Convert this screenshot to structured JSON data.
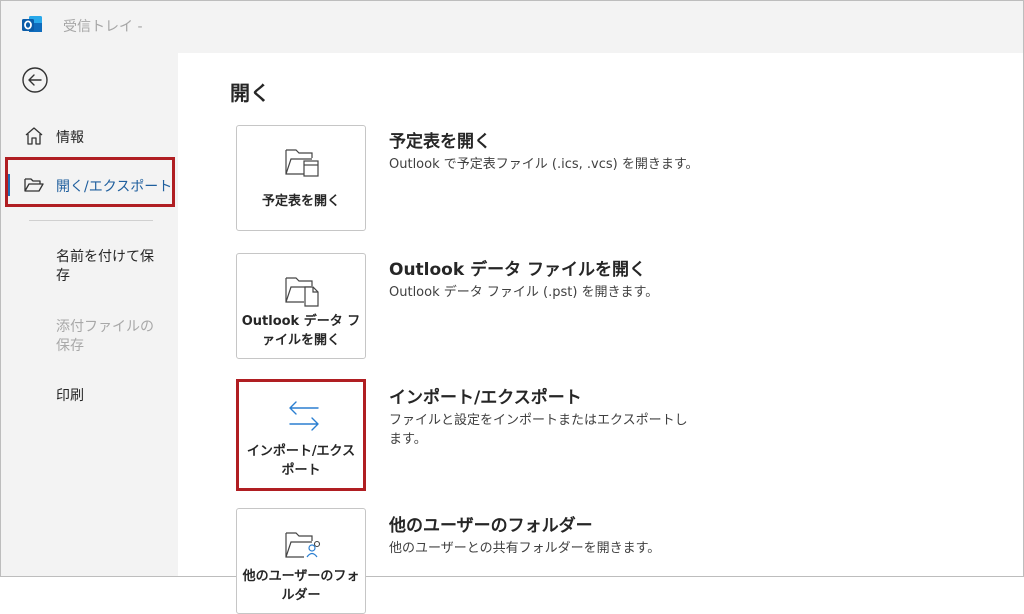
{
  "titlebar": {
    "title": "受信トレイ -",
    "app_icon": "outlook-icon"
  },
  "sidebar": {
    "back_icon": "back-arrow-icon",
    "items": [
      {
        "label": "情報",
        "icon": "home-icon"
      },
      {
        "label": "開く/エクスポート",
        "icon": "folder-open-icon",
        "selected": true
      },
      {
        "label": "名前を付けて保存"
      },
      {
        "label": "添付ファイルの保存",
        "disabled": true
      },
      {
        "label": "印刷"
      }
    ]
  },
  "main": {
    "heading": "開く",
    "options": [
      {
        "tile_label": "予定表を開く",
        "title": "予定表を開く",
        "description": "Outlook で予定表ファイル (.ics, .vcs) を開きます。",
        "icon": "calendar-folder-icon"
      },
      {
        "tile_label": "Outlook データ ファイルを開く",
        "title": "Outlook データ ファイルを開く",
        "description": "Outlook データ ファイル (.pst) を開きます。",
        "icon": "data-file-folder-icon"
      },
      {
        "tile_label": "インポート/エクスポート",
        "title": "インポート/エクスポート",
        "description": "ファイルと設定をインポートまたはエクスポートします。",
        "icon": "import-export-arrows-icon",
        "highlighted": true
      },
      {
        "tile_label": "他のユーザーのフォルダー",
        "title": "他のユーザーのフォルダー",
        "description": "他のユーザーとの共有フォルダーを開きます。",
        "icon": "shared-folder-icon"
      }
    ]
  },
  "colors": {
    "accent": "#1f6cb5",
    "highlight_box": "#b01e22",
    "sidebar_bg": "#f3f3f3"
  }
}
